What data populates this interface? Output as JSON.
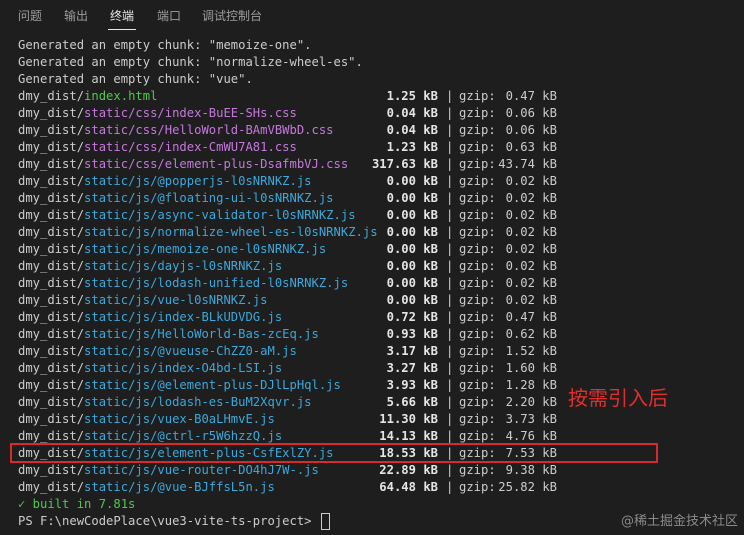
{
  "tabs": [
    {
      "label": "问题",
      "active": false
    },
    {
      "label": "输出",
      "active": false
    },
    {
      "label": "终端",
      "active": true
    },
    {
      "label": "端口",
      "active": false
    },
    {
      "label": "调试控制台",
      "active": false
    }
  ],
  "terminal": {
    "messages": [
      "Generated an empty chunk: \"memoize-one\".",
      "Generated an empty chunk: \"normalize-wheel-es\".",
      "Generated an empty chunk: \"vue\"."
    ],
    "rows": [
      {
        "prefix": "dmy_dist/",
        "file": "index.html",
        "type": "html",
        "size": "1.25 kB",
        "gzip_label": "gzip:",
        "gzip": "0.47 kB"
      },
      {
        "prefix": "dmy_dist/",
        "file": "static/css/index-BuEE-SHs.css",
        "type": "css",
        "size": "0.04 kB",
        "gzip_label": "gzip:",
        "gzip": "0.06 kB"
      },
      {
        "prefix": "dmy_dist/",
        "file": "static/css/HelloWorld-BAmVBWbD.css",
        "type": "css",
        "size": "0.04 kB",
        "gzip_label": "gzip:",
        "gzip": "0.06 kB"
      },
      {
        "prefix": "dmy_dist/",
        "file": "static/css/index-CmWU7A81.css",
        "type": "css",
        "size": "1.23 kB",
        "gzip_label": "gzip:",
        "gzip": "0.63 kB"
      },
      {
        "prefix": "dmy_dist/",
        "file": "static/css/element-plus-DsafmbVJ.css",
        "type": "css",
        "size": "317.63 kB",
        "gzip_label": "gzip:",
        "gzip": "43.74 kB"
      },
      {
        "prefix": "dmy_dist/",
        "file": "static/js/@popperjs-l0sNRNKZ.js",
        "type": "js",
        "size": "0.00 kB",
        "gzip_label": "gzip:",
        "gzip": "0.02 kB"
      },
      {
        "prefix": "dmy_dist/",
        "file": "static/js/@floating-ui-l0sNRNKZ.js",
        "type": "js",
        "size": "0.00 kB",
        "gzip_label": "gzip:",
        "gzip": "0.02 kB"
      },
      {
        "prefix": "dmy_dist/",
        "file": "static/js/async-validator-l0sNRNKZ.js",
        "type": "js",
        "size": "0.00 kB",
        "gzip_label": "gzip:",
        "gzip": "0.02 kB"
      },
      {
        "prefix": "dmy_dist/",
        "file": "static/js/normalize-wheel-es-l0sNRNKZ.js",
        "type": "js",
        "size": "0.00 kB",
        "gzip_label": "gzip:",
        "gzip": "0.02 kB"
      },
      {
        "prefix": "dmy_dist/",
        "file": "static/js/memoize-one-l0sNRNKZ.js",
        "type": "js",
        "size": "0.00 kB",
        "gzip_label": "gzip:",
        "gzip": "0.02 kB"
      },
      {
        "prefix": "dmy_dist/",
        "file": "static/js/dayjs-l0sNRNKZ.js",
        "type": "js",
        "size": "0.00 kB",
        "gzip_label": "gzip:",
        "gzip": "0.02 kB"
      },
      {
        "prefix": "dmy_dist/",
        "file": "static/js/lodash-unified-l0sNRNKZ.js",
        "type": "js",
        "size": "0.00 kB",
        "gzip_label": "gzip:",
        "gzip": "0.02 kB"
      },
      {
        "prefix": "dmy_dist/",
        "file": "static/js/vue-l0sNRNKZ.js",
        "type": "js",
        "size": "0.00 kB",
        "gzip_label": "gzip:",
        "gzip": "0.02 kB"
      },
      {
        "prefix": "dmy_dist/",
        "file": "static/js/index-BLkUDVDG.js",
        "type": "js",
        "size": "0.72 kB",
        "gzip_label": "gzip:",
        "gzip": "0.47 kB"
      },
      {
        "prefix": "dmy_dist/",
        "file": "static/js/HelloWorld-Bas-zcEq.js",
        "type": "js",
        "size": "0.93 kB",
        "gzip_label": "gzip:",
        "gzip": "0.62 kB"
      },
      {
        "prefix": "dmy_dist/",
        "file": "static/js/@vueuse-ChZZ0-aM.js",
        "type": "js",
        "size": "3.17 kB",
        "gzip_label": "gzip:",
        "gzip": "1.52 kB"
      },
      {
        "prefix": "dmy_dist/",
        "file": "static/js/index-O4bd-LSI.js",
        "type": "js",
        "size": "3.27 kB",
        "gzip_label": "gzip:",
        "gzip": "1.60 kB"
      },
      {
        "prefix": "dmy_dist/",
        "file": "static/js/@element-plus-DJlLpHql.js",
        "type": "js",
        "size": "3.93 kB",
        "gzip_label": "gzip:",
        "gzip": "1.28 kB"
      },
      {
        "prefix": "dmy_dist/",
        "file": "static/js/lodash-es-BuM2Xqvr.js",
        "type": "js",
        "size": "5.66 kB",
        "gzip_label": "gzip:",
        "gzip": "2.20 kB"
      },
      {
        "prefix": "dmy_dist/",
        "file": "static/js/vuex-B0aLHmvE.js",
        "type": "js",
        "size": "11.30 kB",
        "gzip_label": "gzip:",
        "gzip": "3.73 kB"
      },
      {
        "prefix": "dmy_dist/",
        "file": "static/js/@ctrl-r5W6hzzQ.js",
        "type": "js",
        "size": "14.13 kB",
        "gzip_label": "gzip:",
        "gzip": "4.76 kB"
      },
      {
        "prefix": "dmy_dist/",
        "file": "static/js/element-plus-CsfExlZY.js",
        "type": "js",
        "size": "18.53 kB",
        "gzip_label": "gzip:",
        "gzip": "7.53 kB"
      },
      {
        "prefix": "dmy_dist/",
        "file": "static/js/vue-router-DO4hJ7W-.js",
        "type": "js",
        "size": "22.89 kB",
        "gzip_label": "gzip:",
        "gzip": "9.38 kB"
      },
      {
        "prefix": "dmy_dist/",
        "file": "static/js/@vue-BJffsL5n.js",
        "type": "js",
        "size": "64.48 kB",
        "gzip_label": "gzip:",
        "gzip": "25.82 kB"
      }
    ],
    "built": "✓ built in 7.81s",
    "prompt": "PS F:\\newCodePlace\\vue3-vite-ts-project>"
  },
  "annotation": "按需引入后",
  "watermark": "@稀土掘金技术社区",
  "colors": {
    "background": "#1e1e1e",
    "html_file": "#4ec94e",
    "css_file": "#c678dd",
    "js_file": "#3ba8db",
    "highlight": "#d62b2b"
  }
}
